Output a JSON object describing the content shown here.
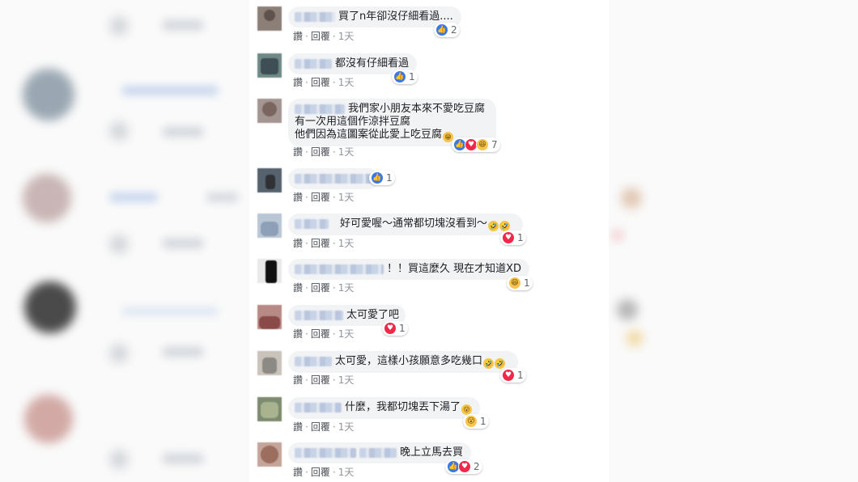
{
  "actions": {
    "like": "讚",
    "reply": "回覆",
    "separator": "·",
    "time": "1天"
  },
  "comments": [
    {
      "text": "買了n年卻沒仔細看過....",
      "reactions": [
        "like"
      ],
      "count": "2"
    },
    {
      "text": "都沒有仔細看過",
      "reactions": [
        "like"
      ],
      "count": "1"
    },
    {
      "text_lines": [
        "我們家小朋友本來不愛吃豆腐",
        "有一次用這個作涼拌豆腐",
        "他們因為這圖案從此愛上吃豆腐"
      ],
      "reactions": [
        "like",
        "love",
        "haha"
      ],
      "count": "7"
    },
    {
      "text": "",
      "reactions": [
        "like"
      ],
      "count": "1"
    },
    {
      "text": "好可愛喔～通常都切塊沒看到～",
      "reactions": [
        "love"
      ],
      "count": "1"
    },
    {
      "text": "！！買這麼久 現在才知道XD",
      "reactions": [
        "haha"
      ],
      "count": "1"
    },
    {
      "text": "太可愛了吧",
      "reactions": [
        "love"
      ],
      "count": "1"
    },
    {
      "text": "太可愛，這樣小孩願意多吃幾口",
      "reactions": [
        "love"
      ],
      "count": "1"
    },
    {
      "text": "什麼，我都切塊丟下湯了",
      "reactions": [
        "wow"
      ],
      "count": "1"
    },
    {
      "text": "晚上立馬去買",
      "reactions": [
        "like",
        "love"
      ],
      "count": "2"
    }
  ],
  "colors": {
    "like": "#3b78e7",
    "love": "#f0284a",
    "haha": "#f7c44c",
    "text": "#1c1e21",
    "meta": "#90949c"
  },
  "icons": {
    "like": "thumbs-up-icon",
    "love": "heart-icon",
    "haha": "laughing-face-icon",
    "wow": "surprised-face-icon"
  }
}
